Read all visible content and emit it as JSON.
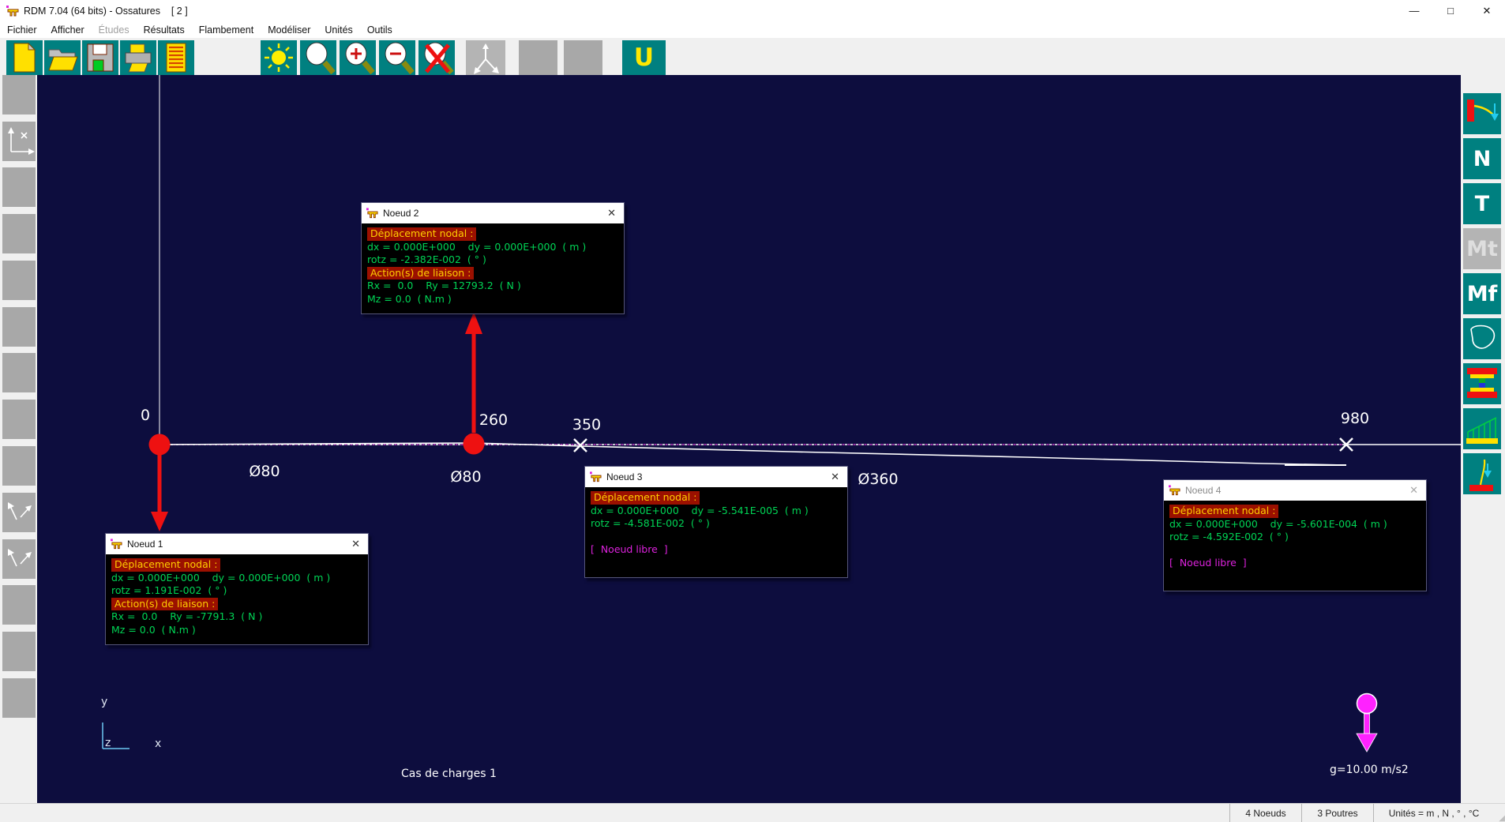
{
  "window": {
    "title": "RDM 7.04 (64 bits) - Ossatures    [ 2 ]",
    "controls": {
      "minimize": "—",
      "maximize": "□",
      "close": "✕"
    }
  },
  "menu": {
    "items": [
      {
        "label": "Fichier",
        "enabled": true
      },
      {
        "label": "Afficher",
        "enabled": true
      },
      {
        "label": "Études",
        "enabled": false
      },
      {
        "label": "Résultats",
        "enabled": true
      },
      {
        "label": "Flambement",
        "enabled": true
      },
      {
        "label": "Modéliser",
        "enabled": true
      },
      {
        "label": "Unités",
        "enabled": true
      },
      {
        "label": "Outils",
        "enabled": true
      }
    ]
  },
  "toolbar": {
    "buttons": [
      "new-file",
      "open-file",
      "save",
      "print",
      "report",
      "brightness",
      "zoom-window",
      "zoom-in",
      "zoom-out",
      "zoom-cancel",
      "axes-3d",
      "empty",
      "empty",
      "u-section"
    ],
    "u_label": "U"
  },
  "left_sidebar": {
    "buttons": [
      "blank",
      "axes",
      "blank",
      "blank",
      "blank",
      "blank",
      "blank",
      "blank",
      "blank",
      "arrows",
      "arrows",
      "blank",
      "blank",
      "blank"
    ]
  },
  "right_sidebar": {
    "buttons": [
      {
        "name": "deformed-shape",
        "label": ""
      },
      {
        "name": "normal-force",
        "label": "N"
      },
      {
        "name": "shear-force",
        "label": "T"
      },
      {
        "name": "torsion-moment",
        "label": "Mt",
        "disabled": true
      },
      {
        "name": "bending-moment",
        "label": "Mf"
      },
      {
        "name": "cross-section",
        "label": ""
      },
      {
        "name": "section-stress",
        "label": ""
      },
      {
        "name": "load-diagram",
        "label": ""
      },
      {
        "name": "mode-shape",
        "label": ""
      }
    ]
  },
  "canvas": {
    "node_labels": [
      "0",
      "260",
      "350",
      "980"
    ],
    "section_labels": [
      "Ø80",
      "Ø80",
      "Ø360"
    ],
    "load_case_label": "Cas de charges 1",
    "gravity_label": "g=10.00 m/s2",
    "axes": {
      "x": "x",
      "y": "y",
      "z": "z"
    },
    "popup_close": "✕",
    "popups": [
      {
        "title": "Noeud 1",
        "header_displacement": "Déplacement nodal :",
        "line_dxdy": "dx = 0.000E+000    dy = 0.000E+000  ( m )",
        "line_rotz": "rotz = 1.191E-002  ( ° )",
        "header_actions": "Action(s) de liaison :",
        "line_rxry": "Rx =  0.0    Ry = -7791.3  ( N )",
        "line_mz": "Mz = 0.0  ( N.m )"
      },
      {
        "title": "Noeud 2",
        "header_displacement": "Déplacement nodal :",
        "line_dxdy": "dx = 0.000E+000    dy = 0.000E+000  ( m )",
        "line_rotz": "rotz = -2.382E-002  ( ° )",
        "header_actions": "Action(s) de liaison :",
        "line_rxry": "Rx =  0.0    Ry = 12793.2  ( N )",
        "line_mz": "Mz = 0.0  ( N.m )"
      },
      {
        "title": "Noeud 3",
        "header_displacement": "Déplacement nodal :",
        "line_dxdy": "dx = 0.000E+000    dy = -5.541E-005  ( m )",
        "line_rotz": "rotz = -4.581E-002  ( ° )",
        "free_node": "[  Noeud libre  ]"
      },
      {
        "title": "Noeud 4",
        "header_displacement": "Déplacement nodal :",
        "line_dxdy": "dx = 0.000E+000    dy = -5.601E-004  ( m )",
        "line_rotz": "rotz = -4.592E-002  ( ° )",
        "free_node": "[  Noeud libre  ]"
      }
    ]
  },
  "status_bar": {
    "nodes": "4 Noeuds",
    "beams": "3 Poutres",
    "units": "Unités = m , N , ° , °C"
  },
  "colors": {
    "canvas_bg": "#0d0d3e",
    "toolbar_teal": "#008080",
    "popup_green": "#00d455",
    "popup_yellow": "#ffce00",
    "popup_header_bg": "#9b1000",
    "free_node_magenta": "#dd22dd",
    "node_red": "#ee1111",
    "gravity_magenta": "#ff22ff",
    "axis_cyan": "#6cc8f2"
  }
}
